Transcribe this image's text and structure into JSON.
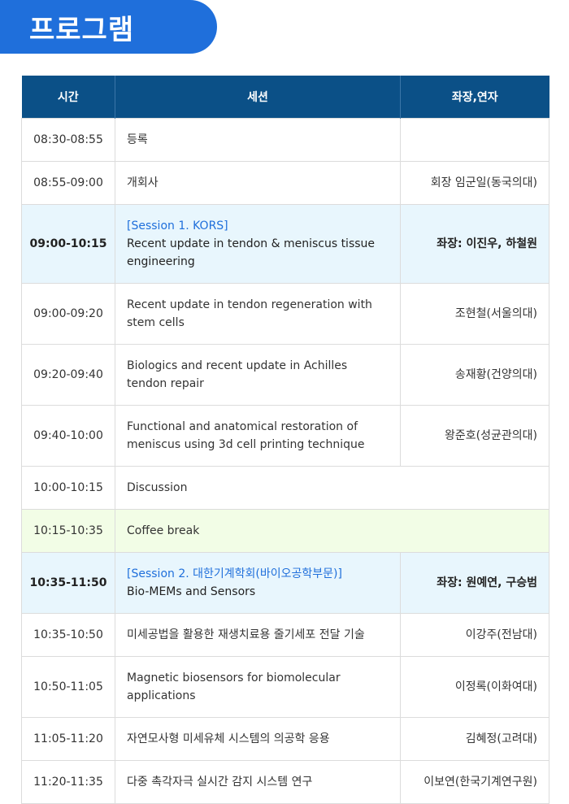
{
  "page_title": "프로그램",
  "headers": {
    "time": "시간",
    "session": "세션",
    "speaker": "좌장,연자"
  },
  "rows": [
    {
      "time": "08:30-08:55",
      "session": "등록",
      "speaker": ""
    },
    {
      "time": "08:55-09:00",
      "session": "개회사",
      "speaker": "회장 임군일(동국의대)"
    },
    {
      "time": "09:00-10:15",
      "tag": "[Session 1. KORS]",
      "session": "Recent update in tendon & meniscus tissue engineering",
      "speaker": "좌장: 이진우, 하철원"
    },
    {
      "time": "09:00-09:20",
      "session": "Recent update in tendon regeneration with stem cells",
      "speaker": "조현철(서울의대)"
    },
    {
      "time": "09:20-09:40",
      "session": "Biologics and recent update in Achilles tendon repair",
      "speaker": "송재황(건양의대)"
    },
    {
      "time": "09:40-10:00",
      "session": "Functional and anatomical restoration of meniscus using 3d cell printing technique",
      "speaker": "왕준호(성균관의대)"
    },
    {
      "time": "10:00-10:15",
      "session": "Discussion"
    },
    {
      "time": "10:15-10:35",
      "session": "Coffee break"
    },
    {
      "time": "10:35-11:50",
      "tag": "[Session 2. 대한기계학회(바이오공학부문)]",
      "session": "Bio-MEMs and Sensors",
      "speaker": "좌장: 원예연, 구승범"
    },
    {
      "time": "10:35-10:50",
      "session": "미세공법을 활용한 재생치료용 줄기세포 전달 기술",
      "speaker": "이강주(전남대)"
    },
    {
      "time": "10:50-11:05",
      "session": "Magnetic biosensors for biomolecular applications",
      "speaker": "이정록(이화여대)"
    },
    {
      "time": "11:05-11:20",
      "session": "자연모사형 미세유체 시스템의 의공학 응용",
      "speaker": "김혜정(고려대)"
    },
    {
      "time": "11:20-11:35",
      "session": "다중 촉각자극 실시간 감지 시스템 연구",
      "speaker": "이보연(한국기계연구원)"
    }
  ],
  "colors": {
    "tab": "#1f6fdb",
    "header": "#0b5087",
    "session_bg": "#e8f6fd",
    "break_bg": "#f2fde6",
    "tag_text": "#1f6fdb"
  }
}
